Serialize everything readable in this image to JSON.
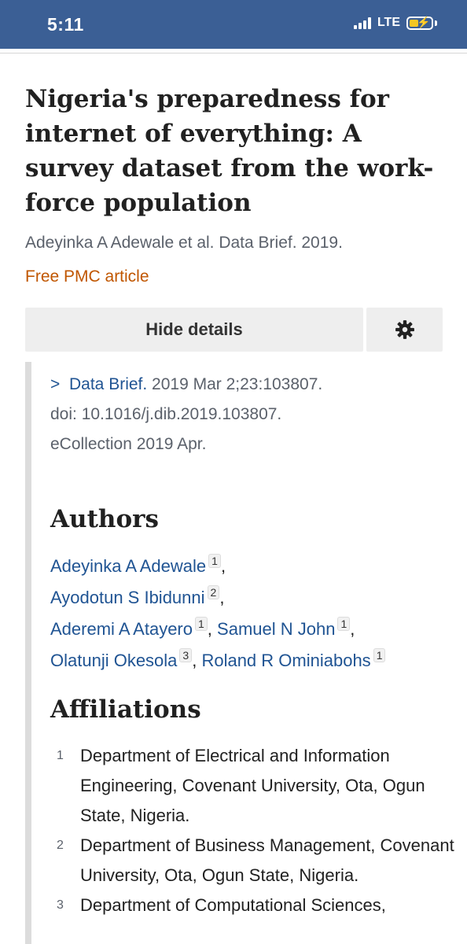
{
  "status_bar": {
    "time": "5:11",
    "network": "LTE"
  },
  "article": {
    "title": "Nigeria's preparedness for internet of everything: A survey dataset from the work-force population",
    "citation": "Adeyinka A Adewale et al. Data Brief. 2019.",
    "free_pmc": "Free PMC article"
  },
  "buttons": {
    "hide_details": "Hide details"
  },
  "details": {
    "journal": "Data Brief.",
    "date_volume": " 2019 Mar 2;23:103807.",
    "doi": "doi: 10.1016/j.dib.2019.103807.",
    "ecollection": "eCollection 2019 Apr."
  },
  "authors_section": {
    "heading": "Authors",
    "authors": [
      {
        "name": "Adeyinka A Adewale",
        "aff": "1"
      },
      {
        "name": "Ayodotun S Ibidunni",
        "aff": "2"
      },
      {
        "name": "Aderemi A Atayero",
        "aff": "1"
      },
      {
        "name": "Samuel N John",
        "aff": "1"
      },
      {
        "name": "Olatunji Okesola",
        "aff": "3"
      },
      {
        "name": "Roland R Ominiabohs",
        "aff": "1"
      }
    ]
  },
  "affiliations_section": {
    "heading": "Affiliations",
    "items": [
      {
        "num": "1",
        "text": "Department of Electrical and Information Engineering, Covenant University, Ota, Ogun State, Nigeria."
      },
      {
        "num": "2",
        "text": "Department of Business Management, Covenant University, Ota, Ogun State, Nigeria."
      },
      {
        "num": "3",
        "text": "Department of Computational Sciences,"
      }
    ]
  }
}
